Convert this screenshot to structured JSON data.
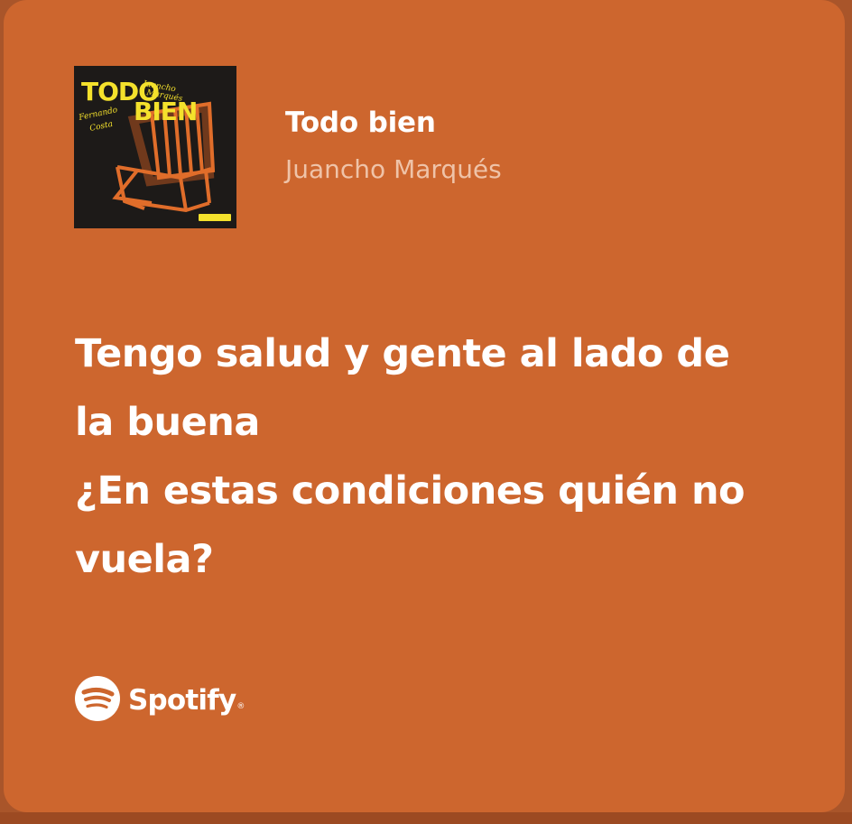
{
  "card": {
    "background_color": "#cd662e",
    "track": {
      "title": "Todo bien",
      "artist": "Juancho Marqués"
    },
    "cover": {
      "title_text": "TODO BIEN",
      "credits": [
        "Juancho Marqués",
        "Fernando Costa"
      ],
      "icon": "lawn-chair-illustration"
    },
    "lyrics": [
      "Tengo salud y gente al lado de",
      "la buena",
      "¿En estas condiciones quién no",
      "vuela?"
    ],
    "brand": {
      "name": "Spotify",
      "icon": "spotify-logo-icon",
      "mark": "®"
    }
  }
}
